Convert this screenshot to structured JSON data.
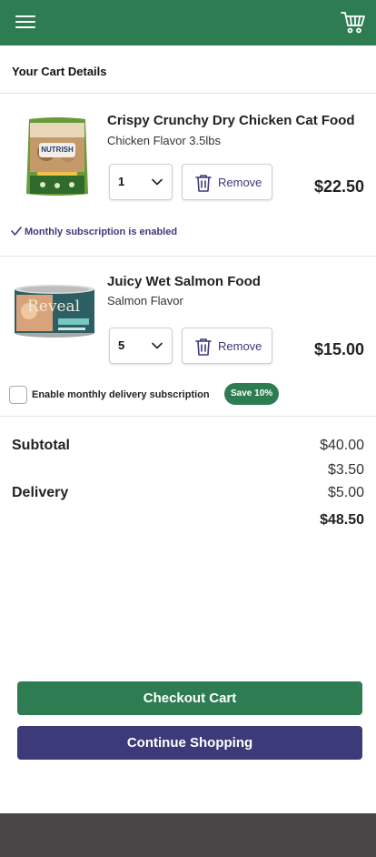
{
  "header": {
    "menu_icon": "hamburger-menu-icon",
    "cart_icon": "shopping-cart-icon",
    "bar_color": "#2e7d52"
  },
  "cart": {
    "title": "Your Cart Details",
    "items": [
      {
        "name": "Crispy Crunchy Dry Chicken Cat Food",
        "variant": "Chicken Flavor 3.5lbs",
        "quantity": "1",
        "remove_label": "Remove",
        "price": "$22.50",
        "subscription_status": "Monthly subscription is enabled",
        "brand_on_package": "NUTRISH"
      },
      {
        "name": "Juicy Wet Salmon Food",
        "variant": "Salmon Flavor",
        "quantity": "5",
        "remove_label": "Remove",
        "price": "$15.00",
        "subscription_option_label": "Enable monthly delivery subscription",
        "subscription_badge": "Save 10%",
        "subscription_checked": false,
        "brand_on_package": "Reveal"
      }
    ]
  },
  "summary": {
    "subtotal_label": "Subtotal",
    "subtotal_value": "$40.00",
    "extra_value": "$3.50",
    "delivery_label": "Delivery",
    "delivery_value": "$5.00",
    "total_value": "$48.50"
  },
  "actions": {
    "checkout_label": "Checkout Cart",
    "continue_label": "Continue Shopping",
    "checkout_color": "#2e7d52",
    "continue_color": "#3d3a7a"
  }
}
